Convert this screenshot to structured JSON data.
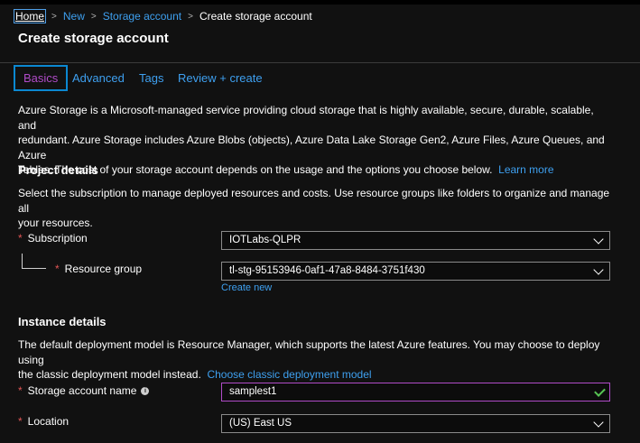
{
  "breadcrumb": {
    "home": "Home",
    "new": "New",
    "storage_account": "Storage account",
    "current": "Create storage account",
    "separator": ">"
  },
  "page": {
    "title": "Create storage account"
  },
  "tabs": [
    {
      "label": "Basics",
      "active": true
    },
    {
      "label": "Advanced",
      "active": false
    },
    {
      "label": "Tags",
      "active": false
    },
    {
      "label": "Review + create",
      "active": false
    }
  ],
  "intro": {
    "line1": "Azure Storage is a Microsoft-managed service providing cloud storage that is highly available, secure, durable, scalable, and",
    "line2": "redundant. Azure Storage includes Azure Blobs (objects), Azure Data Lake Storage Gen2, Azure Files, Azure Queues, and Azure",
    "line3": "Tables. The cost of your storage account depends on the usage and the options you choose below.",
    "learn_more": "Learn more"
  },
  "project_details": {
    "heading": "Project details",
    "line1": "Select the subscription to manage deployed resources and costs. Use resource groups like folders to organize and manage all",
    "line2": "your resources.",
    "subscription_label": "Subscription",
    "subscription_value": "IOTLabs-QLPR",
    "resource_group_label": "Resource group",
    "resource_group_value": "tl-stg-95153946-0af1-47a8-8484-3751f430",
    "create_new": "Create new"
  },
  "instance_details": {
    "heading": "Instance details",
    "line1": "The default deployment model is Resource Manager, which supports the latest Azure features. You may choose to deploy using",
    "line2": "the classic deployment model instead.",
    "classic_link": "Choose classic deployment model",
    "name_label": "Storage account name",
    "name_value": "samplest1",
    "location_label": "Location",
    "location_value": "(US) East US"
  },
  "required_marker": "*",
  "info_glyph": "i",
  "icons": [
    "info-icon",
    "chevron-down-icon",
    "checkmark-icon"
  ],
  "colors": {
    "background": "#111111",
    "link": "#3ea0f0",
    "active_tab_border": "#0b88d1",
    "active_tab_text": "#b04bc8",
    "required": "#e05555",
    "valid_check": "#57c453"
  }
}
